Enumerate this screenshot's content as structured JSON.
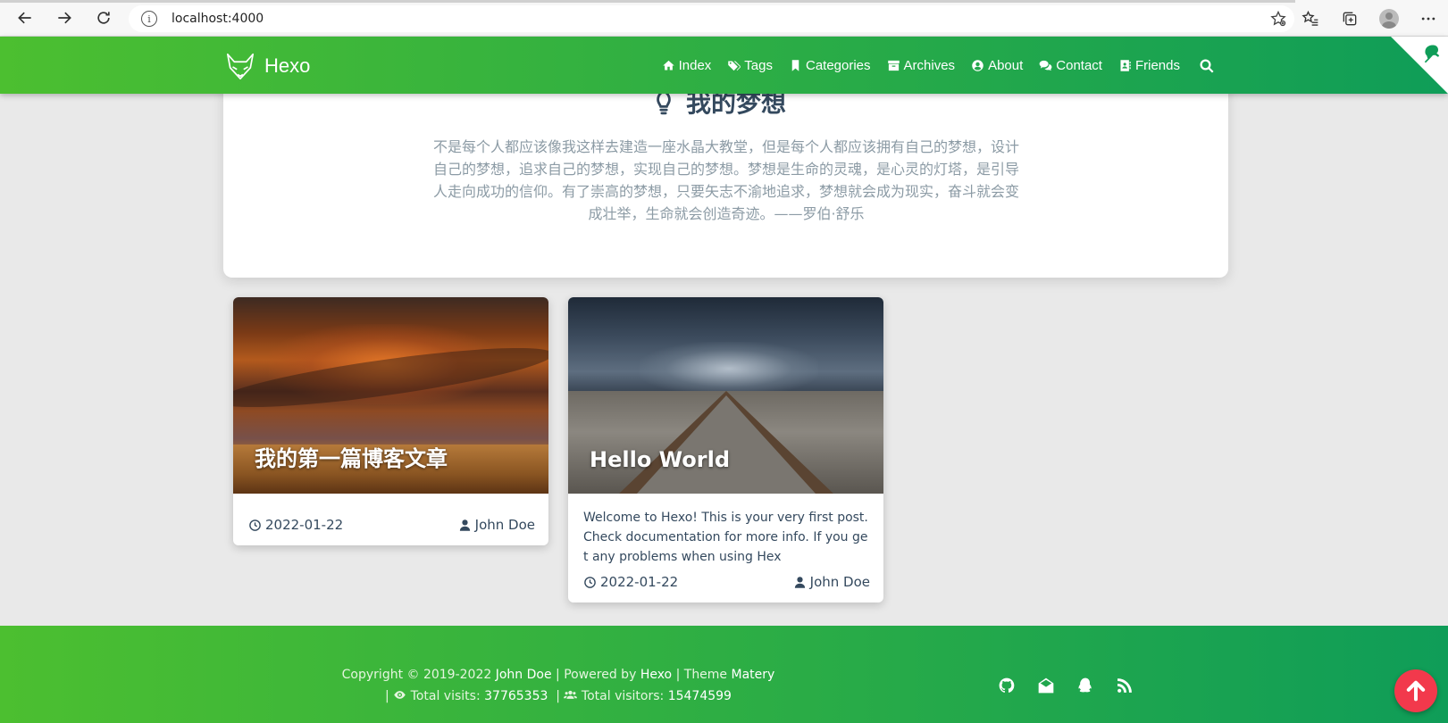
{
  "browser": {
    "url": "localhost:4000",
    "info_glyph": "i"
  },
  "header": {
    "brand": "Hexo",
    "menu": [
      {
        "label": "Index",
        "icon": "home-icon"
      },
      {
        "label": "Tags",
        "icon": "tags-icon"
      },
      {
        "label": "Categories",
        "icon": "bookmark-icon"
      },
      {
        "label": "Archives",
        "icon": "archive-icon"
      },
      {
        "label": "About",
        "icon": "user-circle-icon"
      },
      {
        "label": "Contact",
        "icon": "comments-icon"
      },
      {
        "label": "Friends",
        "icon": "address-book-icon"
      }
    ]
  },
  "dream": {
    "title": "我的梦想",
    "text": "不是每个人都应该像我这样去建造一座水晶大教堂，但是每个人都应该拥有自己的梦想，设计自己的梦想，追求自己的梦想，实现自己的梦想。梦想是生命的灵魂，是心灵的灯塔，是引导人走向成功的信仰。有了崇高的梦想，只要矢志不渝地追求，梦想就会成为现实，奋斗就会变成壮举，生命就会创造奇迹。——罗伯·舒乐"
  },
  "posts": [
    {
      "title": "我的第一篇博客文章",
      "excerpt": "",
      "date": "2022-01-22",
      "author": "John Doe"
    },
    {
      "title": "Hello World",
      "excerpt": "Welcome to Hexo! This is your very first post. Check documentation for more info. If you get any problems when using Hex",
      "date": "2022-01-22",
      "author": "John Doe"
    }
  ],
  "footer": {
    "copyright_prefix": "Copyright © 2019-2022",
    "owner": "John Doe",
    "powered_prefix": "| Powered by",
    "powered": "Hexo",
    "theme_prefix": "| Theme",
    "theme": "Matery",
    "visits_label": "Total visits:",
    "visits": "37765353",
    "visitors_label": "Total visitors:",
    "visitors": "15474599"
  },
  "colors": {
    "header_start": "#4cbf30",
    "header_end": "#0f9d58",
    "back_to_top": "#f2394c",
    "text_dark": "#34495e"
  }
}
